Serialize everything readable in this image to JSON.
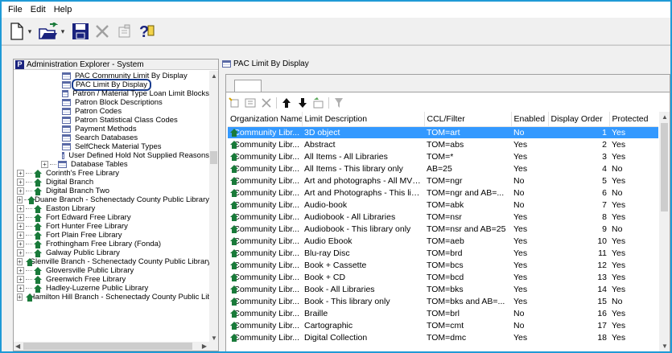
{
  "menu": [
    "File",
    "Edit",
    "Help"
  ],
  "toolbar": {
    "icons": [
      "new-document-icon",
      "open-folder-icon",
      "save-icon",
      "delete-icon",
      "properties-icon",
      "help-icon"
    ]
  },
  "explorer": {
    "title": "Administration Explorer - System",
    "items": [
      {
        "label": "PAC Community Limit By Display",
        "type": "table",
        "indent": 60
      },
      {
        "label": "PAC Limit By Display",
        "type": "table",
        "indent": 60,
        "selected": true
      },
      {
        "label": "Patron / Material Type Loan Limit Blocks",
        "type": "table",
        "indent": 60
      },
      {
        "label": "Patron Block Descriptions",
        "type": "table",
        "indent": 60
      },
      {
        "label": "Patron Codes",
        "type": "table",
        "indent": 60
      },
      {
        "label": "Patron Statistical Class Codes",
        "type": "table",
        "indent": 60
      },
      {
        "label": "Payment Methods",
        "type": "table",
        "indent": 60
      },
      {
        "label": "Search Databases",
        "type": "table",
        "indent": 60
      },
      {
        "label": "SelfCheck Material Types",
        "type": "table",
        "indent": 60
      },
      {
        "label": "User Defined Hold Not Supplied Reasons",
        "type": "table",
        "indent": 60
      },
      {
        "label": "Database Tables",
        "type": "table",
        "indent": 34,
        "expander": "+"
      },
      {
        "label": "Corinth's Free Library",
        "type": "home",
        "indent": 4,
        "expander": "+"
      },
      {
        "label": "Digital Branch",
        "type": "home",
        "indent": 4,
        "expander": "+"
      },
      {
        "label": "Digital Branch Two",
        "type": "home",
        "indent": 4,
        "expander": "+"
      },
      {
        "label": "Duane Branch - Schenectady County Public Library",
        "type": "home",
        "indent": 4,
        "expander": "+"
      },
      {
        "label": "Easton Library",
        "type": "home",
        "indent": 4,
        "expander": "+"
      },
      {
        "label": "Fort Edward Free Library",
        "type": "home",
        "indent": 4,
        "expander": "+"
      },
      {
        "label": "Fort Hunter Free Library",
        "type": "home",
        "indent": 4,
        "expander": "+"
      },
      {
        "label": "Fort Plain Free Library",
        "type": "home",
        "indent": 4,
        "expander": "+"
      },
      {
        "label": "Frothingham Free Library (Fonda)",
        "type": "home",
        "indent": 4,
        "expander": "+"
      },
      {
        "label": "Galway Public Library",
        "type": "home",
        "indent": 4,
        "expander": "+"
      },
      {
        "label": "Glenville Branch - Schenectady County Public Library",
        "type": "home",
        "indent": 4,
        "expander": "+"
      },
      {
        "label": "Gloversville Public Library",
        "type": "home",
        "indent": 4,
        "expander": "+"
      },
      {
        "label": "Greenwich Free Library",
        "type": "home",
        "indent": 4,
        "expander": "+"
      },
      {
        "label": "Hadley-Luzerne Public Library",
        "type": "home",
        "indent": 4,
        "expander": "+"
      },
      {
        "label": "Hamilton Hill Branch - Schenectady County Public Library",
        "type": "home",
        "indent": 4,
        "expander": "+"
      }
    ]
  },
  "detail": {
    "title": "PAC Limit By Display",
    "columns": [
      "Organization Name",
      "Limit Description",
      "CCL/Filter",
      "Enabled",
      "Display Order",
      "Protected"
    ],
    "rows": [
      [
        "Community Libr...",
        "3D object",
        "TOM=art",
        "No",
        "1",
        "Yes"
      ],
      [
        "Community Libr...",
        "Abstract",
        "TOM=abs",
        "Yes",
        "2",
        "Yes"
      ],
      [
        "Community Libr...",
        "All Items - All Libraries",
        "TOM=*",
        "Yes",
        "3",
        "Yes"
      ],
      [
        "Community Libr...",
        "All Items - This library only",
        "AB=25",
        "Yes",
        "4",
        "No"
      ],
      [
        "Community Libr...",
        "Art and photographs - All MVLS-S...",
        "TOM=ngr",
        "No",
        "5",
        "Yes"
      ],
      [
        "Community Libr...",
        "Art and Photographs - This library ...",
        "TOM=ngr and AB=...",
        "No",
        "6",
        "No"
      ],
      [
        "Community Libr...",
        "Audio-book",
        "TOM=abk",
        "No",
        "7",
        "Yes"
      ],
      [
        "Community Libr...",
        "Audiobook - All Libraries",
        "TOM=nsr",
        "Yes",
        "8",
        "Yes"
      ],
      [
        "Community Libr...",
        "Audiobook - This library only",
        "TOM=nsr and AB=25",
        "Yes",
        "9",
        "No"
      ],
      [
        "Community Libr...",
        "Audio Ebook",
        "TOM=aeb",
        "Yes",
        "10",
        "Yes"
      ],
      [
        "Community Libr...",
        "Blu-ray Disc",
        "TOM=brd",
        "Yes",
        "11",
        "Yes"
      ],
      [
        "Community Libr...",
        "Book + Cassette",
        "TOM=bcs",
        "Yes",
        "12",
        "Yes"
      ],
      [
        "Community Libr...",
        "Book + CD",
        "TOM=bcd",
        "Yes",
        "13",
        "Yes"
      ],
      [
        "Community Libr...",
        "Book - All Libraries",
        "TOM=bks",
        "Yes",
        "14",
        "Yes"
      ],
      [
        "Community Libr...",
        "Book - This library only",
        "TOM=bks and AB=...",
        "Yes",
        "15",
        "No"
      ],
      [
        "Community Libr...",
        "Braille",
        "TOM=brl",
        "No",
        "16",
        "Yes"
      ],
      [
        "Community Libr...",
        "Cartographic",
        "TOM=cmt",
        "No",
        "17",
        "Yes"
      ],
      [
        "Community Libr...",
        "Digital Collection",
        "TOM=dmc",
        "Yes",
        "18",
        "Yes"
      ]
    ],
    "selected_row": 0
  },
  "colors": {
    "accent": "#1f9ad6",
    "selection": "#3399ff",
    "tree_selected_outline": "#1a3d8f",
    "home_icon": "#1a7a3a"
  }
}
